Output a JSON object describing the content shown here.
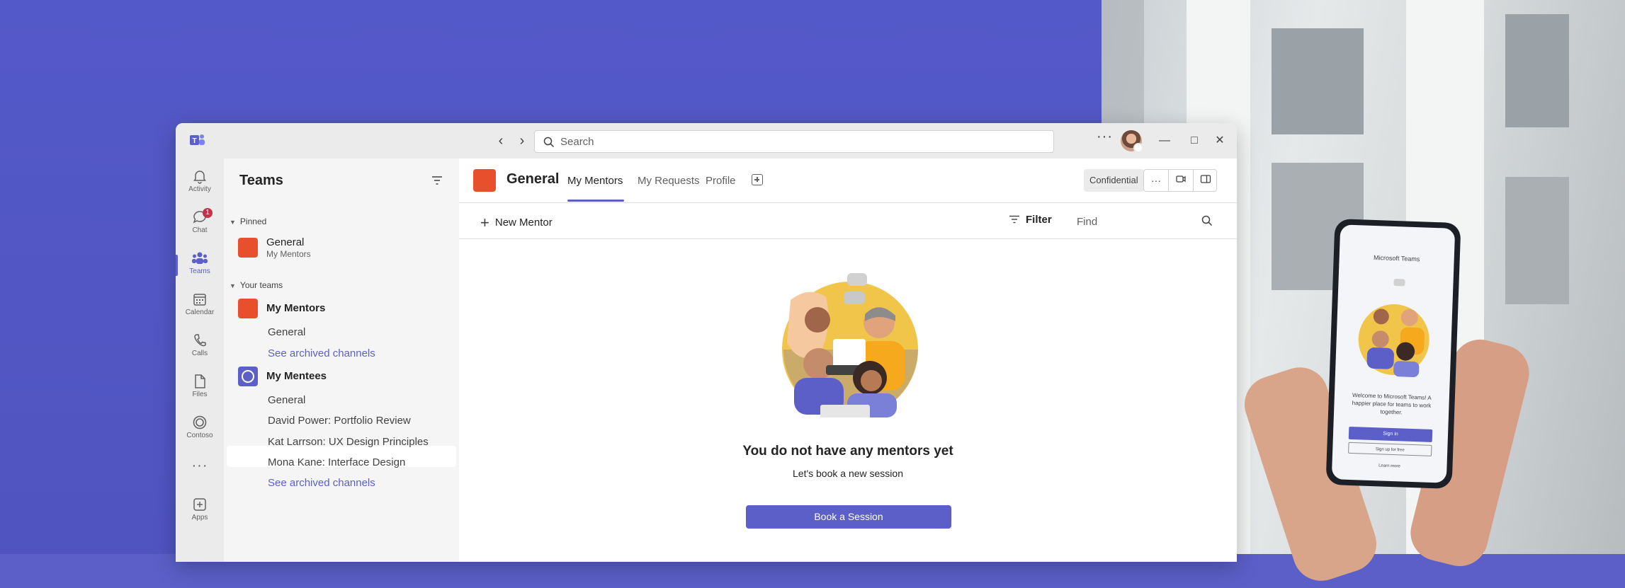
{
  "titlebar": {
    "search_placeholder": "Search",
    "more_label": "···",
    "minimize": "—",
    "maximize": "□",
    "close": "✕"
  },
  "rail": {
    "items": [
      {
        "label": "Activity",
        "icon": "bell-icon"
      },
      {
        "label": "Chat",
        "icon": "chat-icon",
        "badge": "1"
      },
      {
        "label": "Teams",
        "icon": "teams-icon",
        "active": true
      },
      {
        "label": "Calendar",
        "icon": "calendar-icon"
      },
      {
        "label": "Calls",
        "icon": "phone-icon"
      },
      {
        "label": "Files",
        "icon": "file-icon"
      },
      {
        "label": "Contoso",
        "icon": "contoso-icon"
      },
      {
        "label": "",
        "icon": "more-icon"
      },
      {
        "label": "Apps",
        "icon": "apps-icon"
      }
    ]
  },
  "panel": {
    "title": "Teams",
    "pinned_header": "Pinned",
    "pinned": {
      "name": "General",
      "sub": "My Mentors"
    },
    "your_teams_header": "Your teams",
    "teams": [
      {
        "name": "My Mentors",
        "channels": [
          "General"
        ],
        "archived": "See archived channels"
      },
      {
        "name": "My Mentees",
        "channels": [
          "General",
          "David Power: Portfolio Review",
          "Kat Larrson: UX Design Principles",
          "Mona Kane: Interface Design"
        ],
        "archived": "See archived channels"
      }
    ]
  },
  "main": {
    "channel_title": "General",
    "tabs": [
      "My Mentors",
      "My Requests",
      "Profile"
    ],
    "confidential": "Confidential",
    "toolbar": {
      "new_mentor": "New Mentor",
      "filter": "Filter",
      "find_placeholder": "Find"
    },
    "empty": {
      "title": "You do not have any mentors yet",
      "subtitle": "Let's book a new session",
      "button": "Book a Session"
    }
  },
  "phone": {
    "app_title": "Microsoft Teams",
    "welcome": "Welcome to Microsoft Teams! A happier place for teams to work together.",
    "sign_in": "Sign in",
    "sign_up": "Sign up for free",
    "learn_more": "Learn more"
  },
  "colors": {
    "brand": "#5b5fc7",
    "accent_orange": "#e8502d",
    "badge_red": "#c4314b"
  }
}
